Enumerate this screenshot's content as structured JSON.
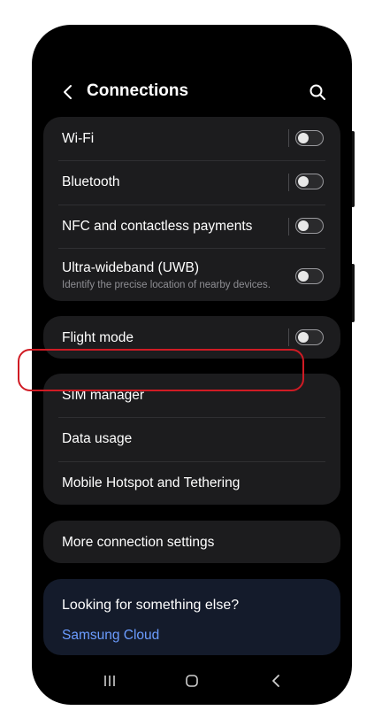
{
  "header": {
    "title": "Connections",
    "back_icon": "chevron-left-icon",
    "search_icon": "search-icon"
  },
  "group1": {
    "items": [
      {
        "label": "Wi-Fi",
        "toggle": "off"
      },
      {
        "label": "Bluetooth",
        "toggle": "off"
      },
      {
        "label": "NFC and contactless payments",
        "toggle": "off"
      },
      {
        "label": "Ultra-wideband (UWB)",
        "sub": "Identify the precise location of nearby devices.",
        "toggle": "off"
      }
    ]
  },
  "group2": {
    "items": [
      {
        "label": "Flight mode",
        "toggle": "off"
      }
    ]
  },
  "group3": {
    "items": [
      {
        "label": "SIM manager"
      },
      {
        "label": "Data usage"
      },
      {
        "label": "Mobile Hotspot and Tethering"
      }
    ]
  },
  "group4": {
    "items": [
      {
        "label": "More connection settings"
      }
    ]
  },
  "suggest": {
    "heading": "Looking for something else?",
    "link": "Samsung Cloud"
  },
  "colors": {
    "highlight": "#d01b24",
    "link": "#6b9cff",
    "card": "#1c1c1e"
  },
  "navbar": {
    "recents_icon": "recents-icon",
    "home_icon": "home-icon",
    "back_icon": "back-icon"
  }
}
